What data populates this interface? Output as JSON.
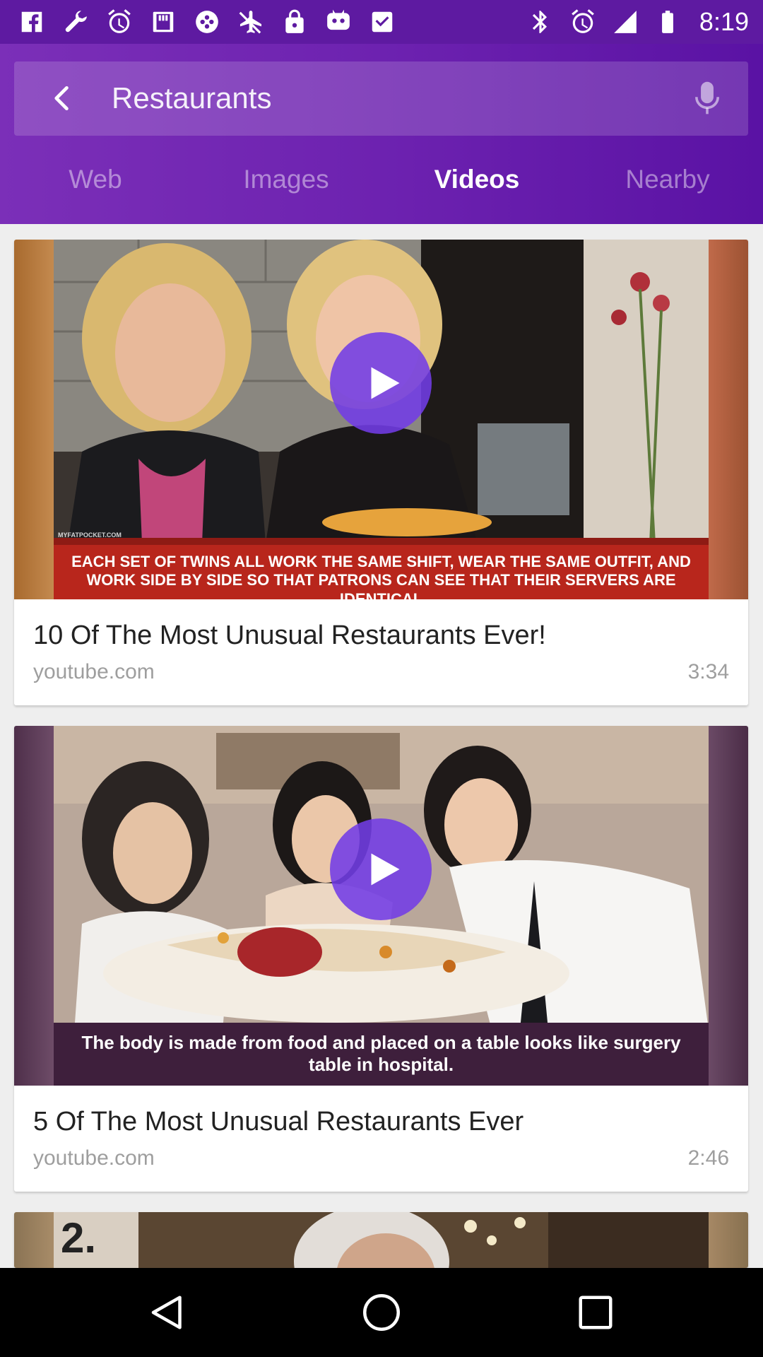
{
  "status_bar": {
    "time": "8:19",
    "left_icons": [
      "facebook-icon",
      "wrench-icon",
      "alarm-icon",
      "instagram-icon",
      "settings-icon",
      "plane-off-icon",
      "lock-icon",
      "robot-icon",
      "inbox-icon"
    ],
    "right_icons": [
      "bluetooth-icon",
      "alarm-icon",
      "signal-icon",
      "battery-icon"
    ]
  },
  "search": {
    "query": "Restaurants"
  },
  "tabs": [
    {
      "label": "Web",
      "active": false
    },
    {
      "label": "Images",
      "active": false
    },
    {
      "label": "Videos",
      "active": true
    },
    {
      "label": "Nearby",
      "active": false
    }
  ],
  "results": [
    {
      "title": "10 Of The Most Unusual Restaurants Ever!",
      "source": "youtube.com",
      "duration": "3:34",
      "caption": "EACH SET OF TWINS ALL WORK THE SAME SHIFT, WEAR THE SAME OUTFIT, AND WORK SIDE BY SIDE SO THAT PATRONS CAN SEE THAT THEIR SERVERS ARE IDENTICAL",
      "watermark": "MYFATPOCKET.COM"
    },
    {
      "title": "5 Of The Most Unusual Restaurants Ever",
      "source": "youtube.com",
      "duration": "2:46",
      "caption": "The body is made from food and placed on a table looks like surgery table in hospital."
    },
    {
      "thumb_text": "2."
    }
  ],
  "colors": {
    "header_start": "#7b2fb8",
    "header_end": "#5a12a4",
    "status_bar": "#5e1aa1",
    "play_button": "#723ce6"
  }
}
